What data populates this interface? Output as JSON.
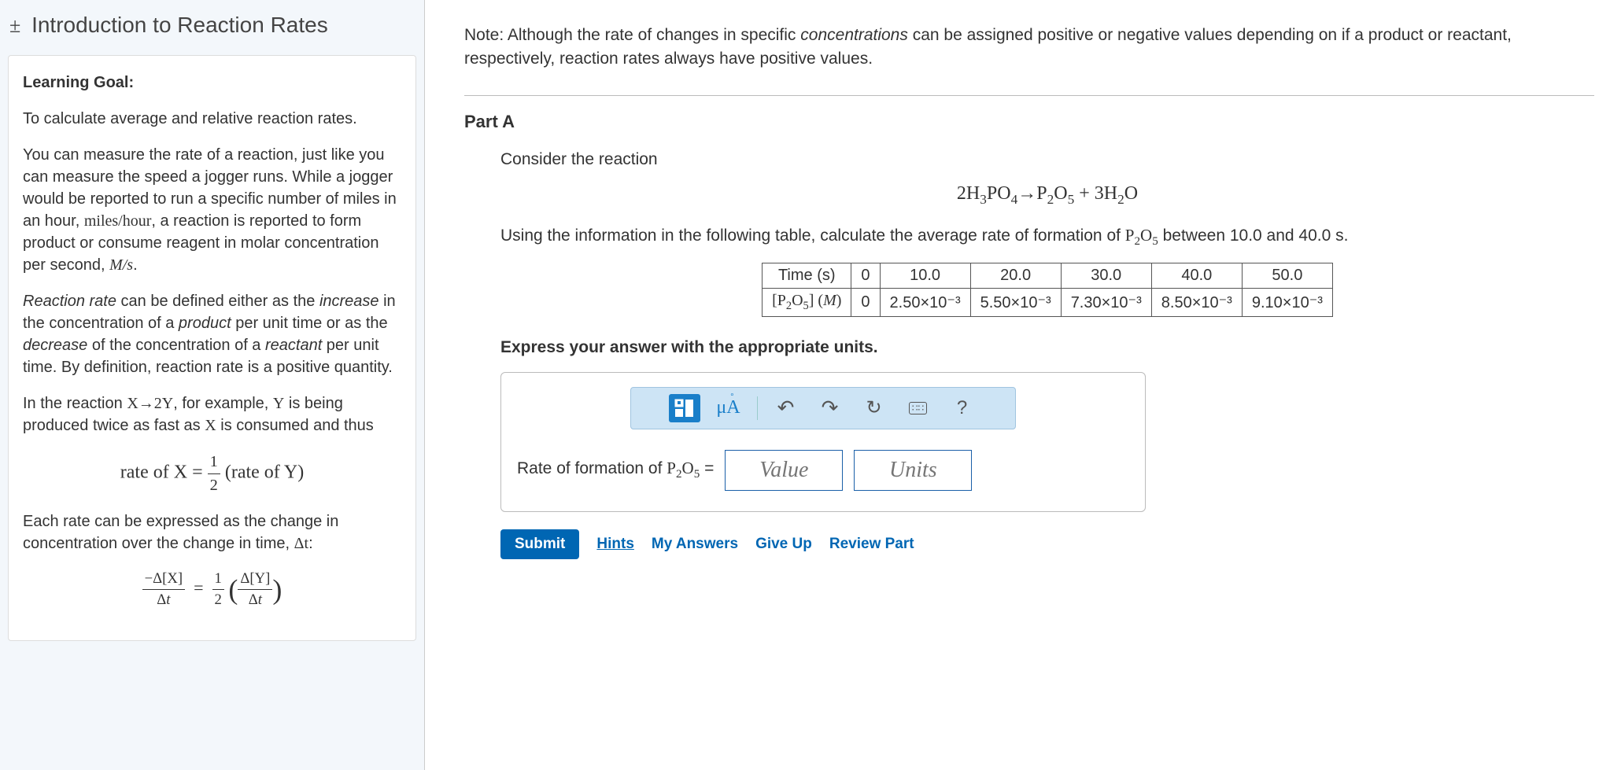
{
  "title": "Introduction to Reaction Rates",
  "learning": {
    "heading": "Learning Goal:",
    "goal": "To calculate average and relative reaction rates.",
    "p1a": "You can measure the rate of a reaction, just like you can measure the speed a jogger runs. While a jogger would be reported to run a specific number of miles in an hour, ",
    "p1b": "miles/hour",
    "p1c": ", a reaction is reported to form product or consume reagent in molar concentration per second, ",
    "p1d": "M/s",
    "p1e": ".",
    "p2a": "Reaction rate",
    "p2b": " can be defined either as the ",
    "p2c": "increase",
    "p2d": " in the concentration of a ",
    "p2e": "product",
    "p2f": " per unit time or as the ",
    "p2g": "decrease",
    "p2h": " of the concentration of a ",
    "p2i": "reactant",
    "p2j": " per unit time. By definition, reaction rate is a positive quantity.",
    "p3a": "In the reaction ",
    "p3b": "X→2Y",
    "p3c": ", for example, ",
    "p3d": "Y",
    "p3e": " is being produced twice as fast as ",
    "p3f": "X",
    "p3g": " is consumed and thus",
    "eq1_lhs": "rate of X",
    "eq1_eq": " = ",
    "eq1_rhs": "(rate of Y)",
    "p4a": "Each rate can be expressed as the change in concentration over the change in time, ",
    "p4b": "Δt",
    "p4c": ":"
  },
  "note": {
    "a": "Note: Although the rate of changes in specific ",
    "b": "concentrations",
    "c": " can be assigned positive or negative values depending on if a product or reactant, respectively, reaction rates always have positive values."
  },
  "part": {
    "title": "Part A",
    "intro": "Consider the reaction",
    "instr_a": "Using the information in the following table, calculate the average rate of formation of ",
    "instr_b": " between 10.0 and 40.0 s.",
    "express": "Express your answer with the appropriate units.",
    "answer_label_a": "Rate of formation of ",
    "answer_label_b": " = "
  },
  "table": {
    "h_time": "Time (s)",
    "h_conc": "[P₂O₅] (M)",
    "times": [
      "0",
      "10.0",
      "20.0",
      "30.0",
      "40.0",
      "50.0"
    ],
    "conc": [
      "0",
      "2.50×10⁻³",
      "5.50×10⁻³",
      "7.30×10⁻³",
      "8.50×10⁻³",
      "9.10×10⁻³"
    ]
  },
  "inputs": {
    "value_ph": "Value",
    "units_ph": "Units"
  },
  "toolbar": {
    "templates": "templates-icon",
    "symbols": "μÅ",
    "undo": "↶",
    "redo": "↷",
    "reset": "↻",
    "keyboard": "⌨",
    "help": "?"
  },
  "actions": {
    "submit": "Submit",
    "hints": "Hints",
    "my_answers": "My Answers",
    "give_up": "Give Up",
    "review": "Review Part"
  }
}
